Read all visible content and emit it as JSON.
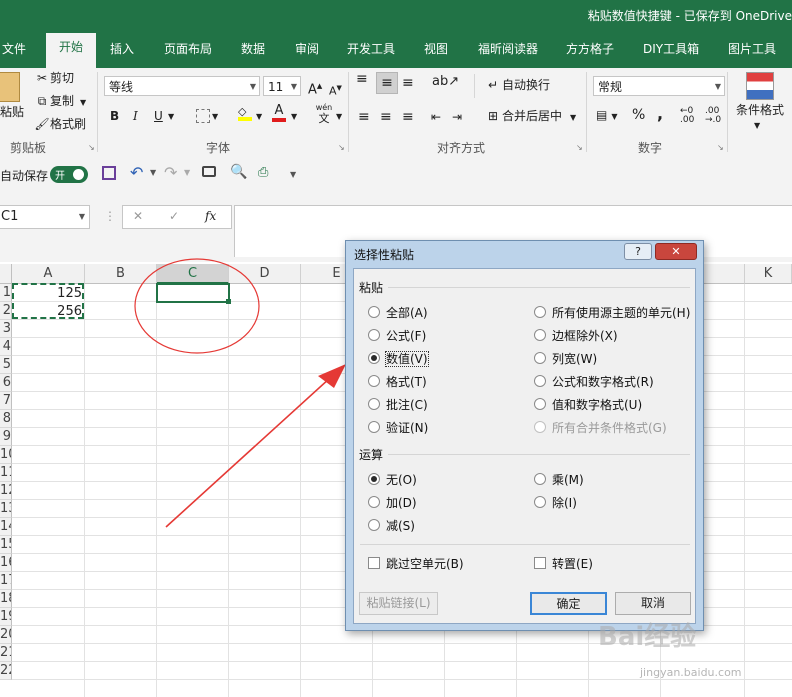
{
  "window": {
    "title": "粘贴数值快捷键 - 已保存到 OneDrive"
  },
  "tabs": [
    "文件",
    "开始",
    "插入",
    "页面布局",
    "数据",
    "审阅",
    "开发工具",
    "视图",
    "福昕阅读器",
    "方方格子",
    "DIY工具箱",
    "图片工具"
  ],
  "ribbon": {
    "clipboard": {
      "paste": "粘贴",
      "cut": "剪切",
      "copy": "复制",
      "format_painter": "格式刷",
      "label": "剪贴板"
    },
    "font": {
      "name": "等线",
      "size": "11",
      "bold": "B",
      "italic": "I",
      "underline": "U",
      "font_color_letter": "A",
      "wen": "wén",
      "wen2": "文",
      "label": "字体"
    },
    "alignment": {
      "wrap_text": "自动换行",
      "merge_center": "合并后居中",
      "label": "对齐方式"
    },
    "number": {
      "format": "常规",
      "percent": "%",
      "comma": ",",
      "label": "数字"
    },
    "styles": {
      "conditional": "条件格式"
    }
  },
  "qat": {
    "autosave_label": "自动保存",
    "toggle_text": "开"
  },
  "formula_bar": {
    "name_box": "C1",
    "fx": "fx",
    "cancel": "✕",
    "enter": "✓"
  },
  "sheet": {
    "columns": [
      "A",
      "B",
      "C",
      "D",
      "E",
      "K"
    ],
    "rows": [
      "1",
      "2",
      "3",
      "4",
      "5",
      "6",
      "7",
      "8",
      "9",
      "10",
      "11",
      "12",
      "13",
      "14",
      "15",
      "16",
      "17",
      "18",
      "19",
      "20",
      "21",
      "22"
    ],
    "cells": {
      "A1": "125",
      "A2": "256"
    }
  },
  "dialog": {
    "title": "选择性粘贴",
    "help": "?",
    "close": "✕",
    "paste_section": "粘贴",
    "paste_options_left": [
      "全部(A)",
      "公式(F)",
      "数值(V)",
      "格式(T)",
      "批注(C)",
      "验证(N)"
    ],
    "paste_options_right": [
      "所有使用源主题的单元(H)",
      "边框除外(X)",
      "列宽(W)",
      "公式和数字格式(R)",
      "值和数字格式(U)",
      "所有合并条件格式(G)"
    ],
    "selected_paste": "数值(V)",
    "operation_section": "运算",
    "operation_left": [
      "无(O)",
      "加(D)",
      "减(S)"
    ],
    "operation_right": [
      "乘(M)",
      "除(I)"
    ],
    "selected_operation": "无(O)",
    "skip_blanks": "跳过空单元(B)",
    "transpose": "转置(E)",
    "paste_link": "粘贴链接(L)",
    "ok": "确定",
    "cancel": "取消"
  },
  "watermark": {
    "brand": "Bai经验",
    "url": "jingyan.baidu.com"
  },
  "colors": {
    "excel_green": "#217346",
    "annotation_red": "#e53935"
  }
}
